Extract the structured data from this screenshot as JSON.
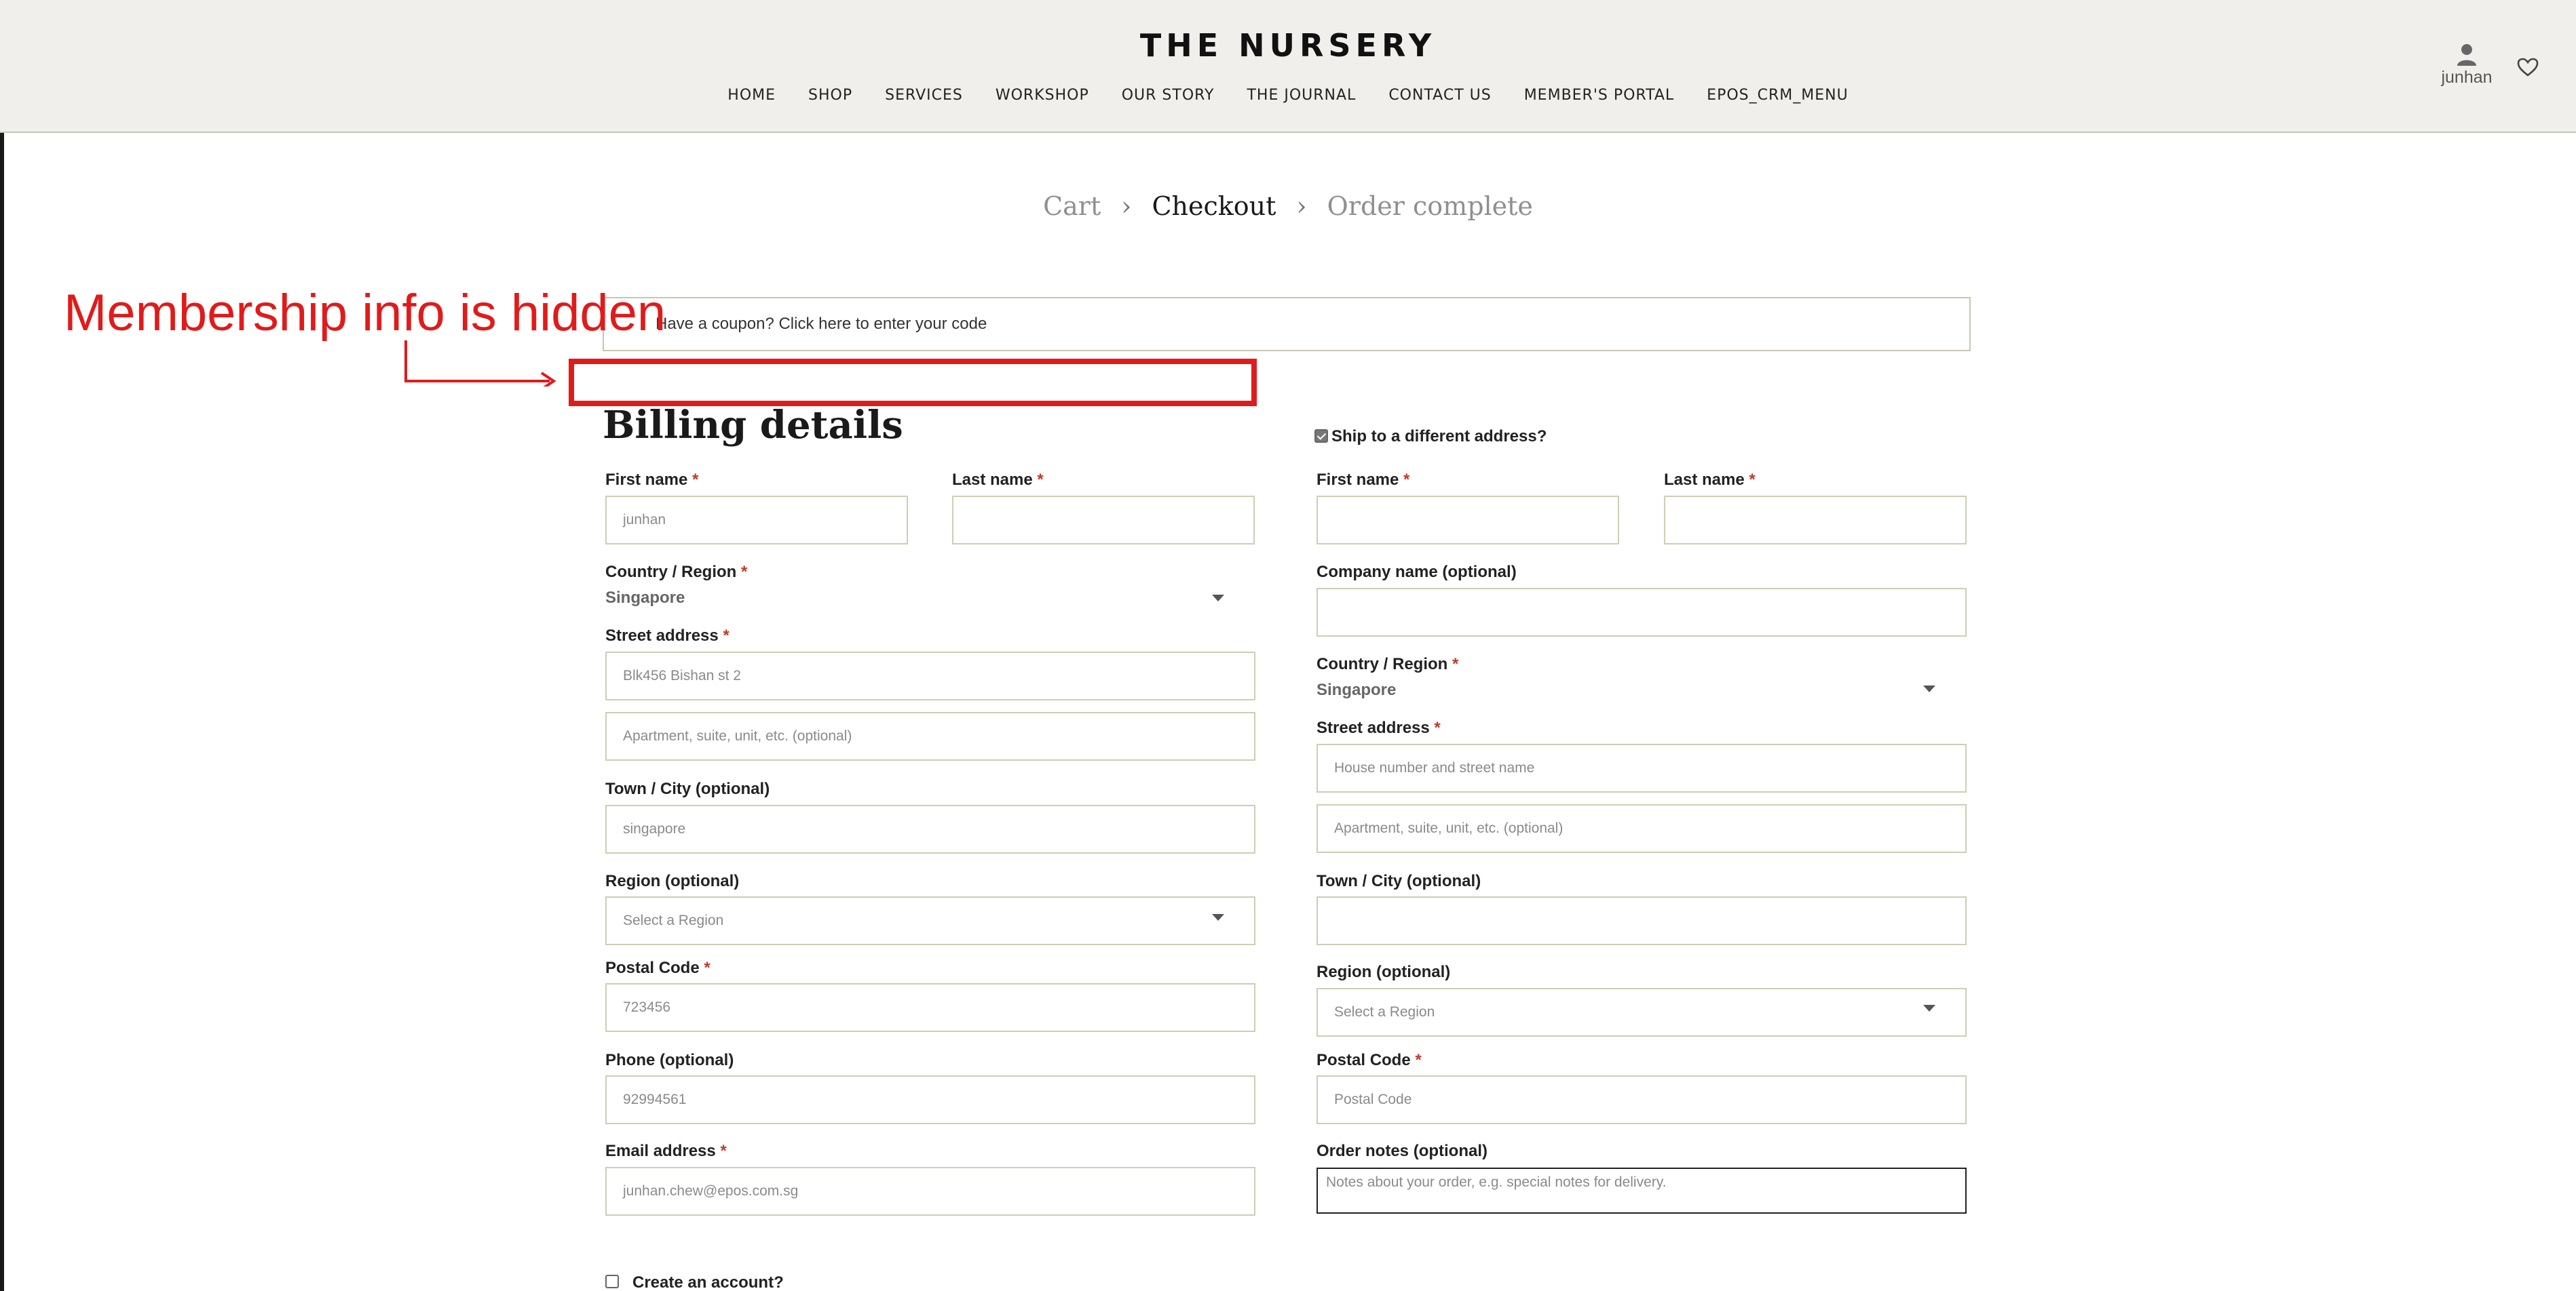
{
  "header": {
    "logo": "THE NURSERY",
    "nav": [
      "HOME",
      "SHOP",
      "SERVICES",
      "WORKSHOP",
      "OUR STORY",
      "THE JOURNAL",
      "CONTACT US",
      "MEMBER'S PORTAL",
      "EPOS_CRM_MENU"
    ],
    "account_name": "junhan"
  },
  "breadcrumb": {
    "cart": "Cart",
    "checkout": "Checkout",
    "complete": "Order complete",
    "separator": "›"
  },
  "annotation": {
    "text": "Membership info is hidden",
    "color": "#e01b1b"
  },
  "coupon": {
    "text": "Have a coupon? Click here to enter your code"
  },
  "billing": {
    "title": "Billing details",
    "first_name_label": "First name",
    "first_name_value": "junhan",
    "last_name_label": "Last name",
    "last_name_value": "",
    "country_label": "Country / Region",
    "country_value": "Singapore",
    "street_label": "Street address",
    "street_value": "Blk456 Bishan st 2",
    "apartment_placeholder": "Apartment, suite, unit, etc. (optional)",
    "city_label": "Town / City (optional)",
    "city_value": "singapore",
    "region_label": "Region (optional)",
    "region_placeholder": "Select a Region",
    "postal_label": "Postal Code",
    "postal_value": "723456",
    "phone_label": "Phone (optional)",
    "phone_value": "92994561",
    "email_label": "Email address",
    "email_value": "junhan.chew@epos.com.sg",
    "create_account_label": "Create an account?"
  },
  "shipping": {
    "ship_different_label": "Ship to a different address?",
    "ship_different_checked": true,
    "first_name_label": "First name",
    "last_name_label": "Last name",
    "company_label": "Company name (optional)",
    "country_label": "Country / Region",
    "country_value": "Singapore",
    "street_label": "Street address",
    "street_placeholder": "House number and street name",
    "apartment_placeholder": "Apartment, suite, unit, etc. (optional)",
    "city_label": "Town / City (optional)",
    "region_label": "Region (optional)",
    "region_placeholder": "Select a Region",
    "postal_label": "Postal Code",
    "postal_placeholder": "Postal Code",
    "notes_label": "Order notes (optional)",
    "notes_placeholder": "Notes about your order, e.g. special notes for delivery."
  },
  "required_marker": "*"
}
